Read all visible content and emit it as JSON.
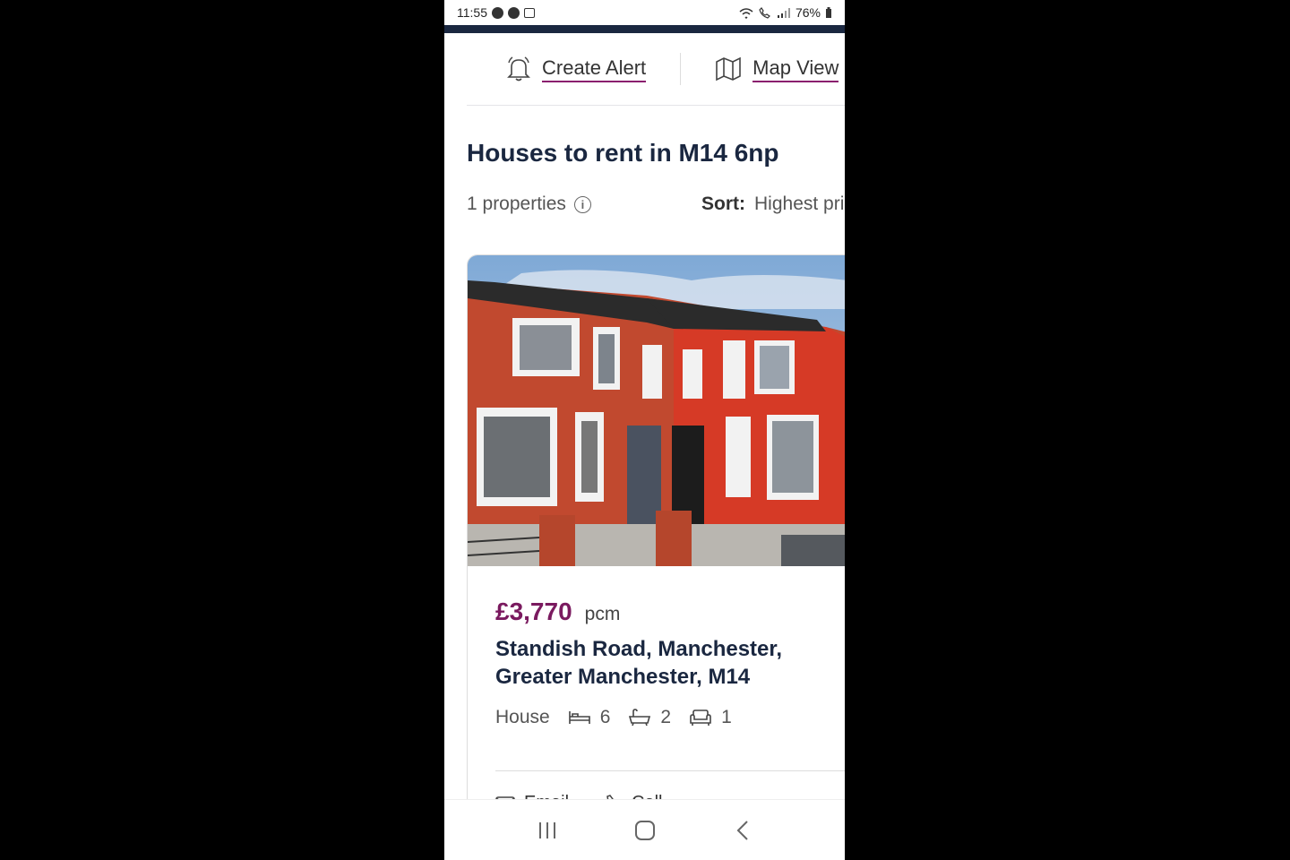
{
  "status": {
    "time": "11:55",
    "battery": "76%"
  },
  "actions": {
    "alert_label": "Create Alert",
    "map_label": "Map View"
  },
  "page": {
    "title": "Houses to rent in M14 6np",
    "count": "1 properties",
    "sort_label": "Sort:",
    "sort_value": "Highest price"
  },
  "listing": {
    "price": "£3,770",
    "price_unit": "pcm",
    "address_line1": "Standish Road, Manchester,",
    "address_line2": "Greater Manchester, M14",
    "type": "House",
    "bedrooms": "6",
    "bathrooms": "2",
    "receptions": "1",
    "email_label": "Email",
    "call_label": "Call"
  },
  "colors": {
    "accent": "#7a1a5f",
    "navy": "#1a2740"
  }
}
